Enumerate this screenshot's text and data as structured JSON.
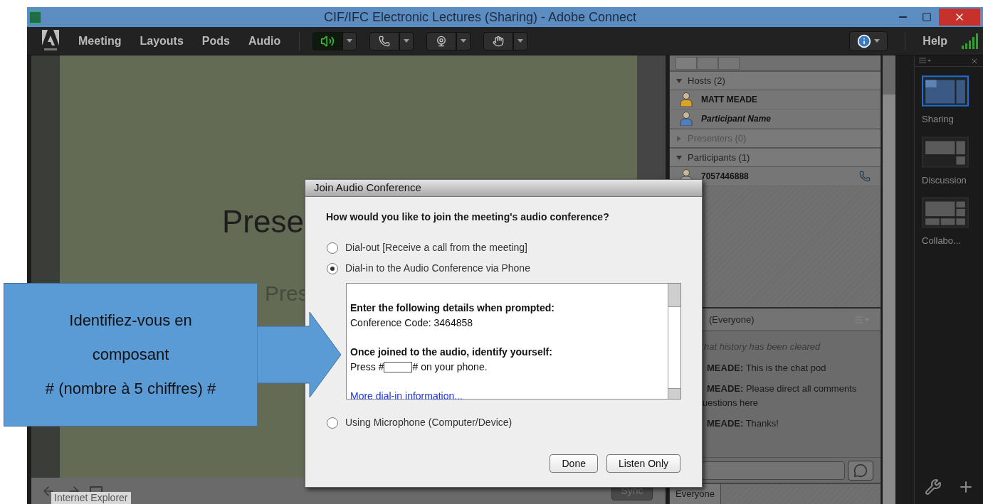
{
  "window": {
    "title": "CIF/IFC Electronic Lectures (Sharing) - Adobe Connect"
  },
  "menu": [
    "Meeting",
    "Layouts",
    "Pods",
    "Audio"
  ],
  "toolbar": [
    {
      "kind": "speaker",
      "on": true
    },
    {
      "kind": "phone",
      "on": false
    },
    {
      "kind": "camera",
      "on": false
    },
    {
      "kind": "hand",
      "on": false
    }
  ],
  "help": "Help",
  "share_pod": {
    "slide_title": "Prese",
    "slide_subtitle": "Pres",
    "tooltip": "Internet Explorer",
    "sync_button": "Sync"
  },
  "attendees": {
    "groups": [
      {
        "label": "Hosts (2)",
        "expanded": true,
        "people": [
          {
            "name": "MATT MEADE",
            "kind": "host",
            "phone": false
          },
          {
            "name": "Participant Name",
            "kind": "self",
            "phone": false
          }
        ]
      },
      {
        "label": "Presenters (0)",
        "expanded": false
      },
      {
        "label": "Participants (1)",
        "expanded": true,
        "people": [
          {
            "name": "7057446888",
            "kind": "participant",
            "phone": true
          }
        ]
      }
    ]
  },
  "chat": {
    "header": "(Everyone)",
    "messages": [
      {
        "kind": "system",
        "text": "hat history has been cleared"
      },
      {
        "kind": "message",
        "sender": "MEADE:",
        "text": "This is the chat pod"
      },
      {
        "kind": "message",
        "sender": "MEADE:",
        "text": "Please direct all comments",
        "continuation": "uestions here"
      },
      {
        "kind": "message",
        "sender": "MEADE:",
        "text": "Thanks!"
      }
    ],
    "tab": "Everyone"
  },
  "layouts": [
    {
      "label": "Sharing",
      "kind": "sharing",
      "selected": true
    },
    {
      "label": "Discussion",
      "kind": "discussion",
      "selected": false
    },
    {
      "label": "Collabo...",
      "kind": "collaboration",
      "selected": false
    }
  ],
  "dialog": {
    "title": "Join Audio Conference",
    "question": "How would you like to join the meeting's audio conference?",
    "options": [
      {
        "label": "Dial-out [Receive a call from the meeting]",
        "selected": false
      },
      {
        "label": "Dial-in to the Audio Conference via Phone",
        "selected": true,
        "details": {
          "heading1": "Enter the following details when prompted:",
          "code": "Conference Code: 3464858",
          "heading2": "Once joined to the audio, identify yourself:",
          "press_before": "Press #",
          "press_after": "# on your phone.",
          "link": "More dial-in information..."
        }
      },
      {
        "label": "Using Microphone (Computer/Device)",
        "selected": false
      }
    ],
    "buttons": [
      "Done",
      "Listen Only"
    ]
  },
  "callout": {
    "lines": [
      "Identifiez-vous en",
      "composant",
      "# (nombre à 5 chiffres) #"
    ]
  }
}
